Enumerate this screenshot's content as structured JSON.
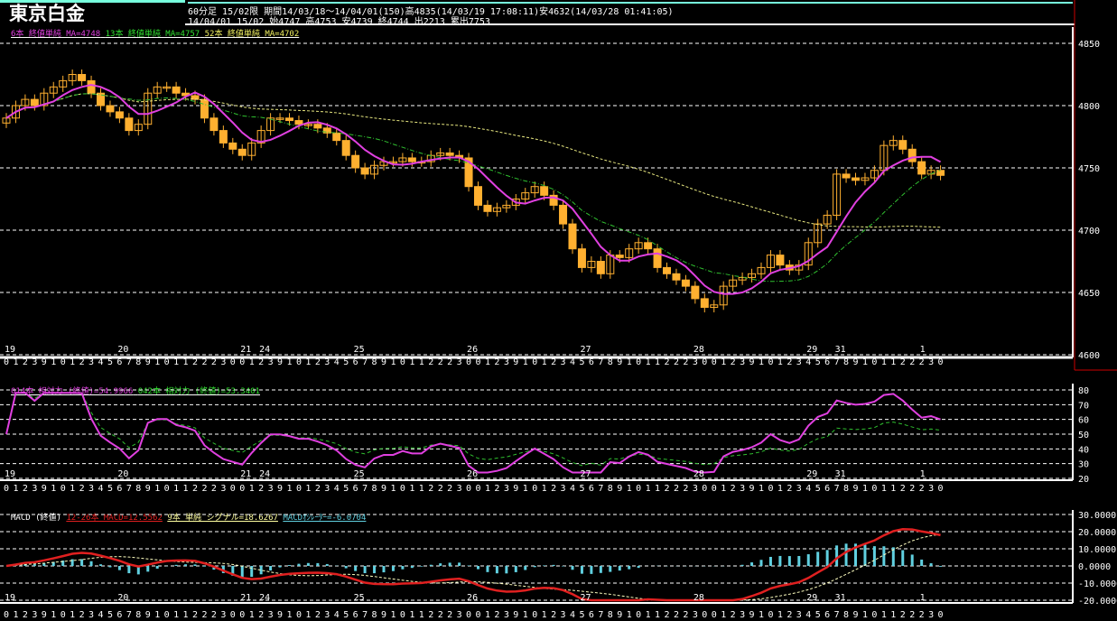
{
  "header": {
    "title": "東京白金",
    "line1": "60分足 15/02限  期間14/03/18～14/04/01(150)高4835(14/03/19 17:08:11)安4632(14/03/28 01:41:05)",
    "line2": "14/04/01 15/02 始4747 高4753 安4739 終4744 出2213 累出7753"
  },
  "legend_main": {
    "ma6": "6本 終値単純 MA=4748",
    "ma13": "13本 終値単純 MA=4757",
    "ma52": "52本 終値単純 MA=4702"
  },
  "legend_rsi": {
    "rsi14": "014本 相対力 (終値)=54.9966",
    "rsi42": "042本 相対力 (終値)=53.3401"
  },
  "legend_macd": {
    "title": "MACD (終値)",
    "macd": "12-26本 MACD=12.5562",
    "signal": "9本 単純 シグナル=18.6267",
    "osc": "MACDｵｼﾚｰﾀｰ=-6.0704"
  },
  "colors": {
    "candle": "#ffb030",
    "ma6": "#e040e0",
    "ma13": "#30c030",
    "ma52": "#e8e880",
    "macd": "#e02020",
    "signal": "#ffffc0",
    "osc": "#60d0e0",
    "grid": "#ffffff"
  },
  "hour_ticks": "0123910123456789101122230",
  "chart_data": [
    {
      "type": "candlestick",
      "ylim": [
        4600,
        4850
      ],
      "yticks": [
        "4850",
        "4800",
        "4750",
        "4700",
        "4650",
        "4600"
      ],
      "close": [
        4790,
        4800,
        4805,
        4800,
        4810,
        4815,
        4820,
        4825,
        4820,
        4810,
        4800,
        4795,
        4790,
        4780,
        4785,
        4810,
        4815,
        4815,
        4810,
        4808,
        4805,
        4790,
        4780,
        4770,
        4765,
        4760,
        4770,
        4780,
        4790,
        4790,
        4788,
        4785,
        4785,
        4782,
        4778,
        4772,
        4760,
        4750,
        4745,
        4752,
        4755,
        4755,
        4758,
        4755,
        4755,
        4760,
        4762,
        4760,
        4758,
        4735,
        4720,
        4715,
        4718,
        4720,
        4725,
        4730,
        4735,
        4728,
        4720,
        4705,
        4685,
        4670,
        4675,
        4665,
        4680,
        4678,
        4685,
        4690,
        4685,
        4670,
        4665,
        4660,
        4655,
        4645,
        4638,
        4640,
        4655,
        4660,
        4662,
        4665,
        4670,
        4680,
        4672,
        4668,
        4672,
        4690,
        4705,
        4712,
        4745,
        4742,
        4740,
        4742,
        4748,
        4768,
        4772,
        4765,
        4755,
        4745,
        4748,
        4744
      ],
      "date_labels": [
        {
          "label": "19",
          "bar": 0
        },
        {
          "label": "20",
          "bar": 12
        },
        {
          "label": "21",
          "bar": 25
        },
        {
          "label": "24",
          "bar": 27
        },
        {
          "label": "25",
          "bar": 37
        },
        {
          "label": "26",
          "bar": 49
        },
        {
          "label": "27",
          "bar": 61
        },
        {
          "label": "28",
          "bar": 73
        },
        {
          "label": "29",
          "bar": 85
        },
        {
          "label": "31",
          "bar": 88
        },
        {
          "label": "1",
          "bar": 97
        }
      ]
    },
    {
      "type": "line",
      "name": "RSI",
      "ylim": [
        20,
        80
      ],
      "yticks": [
        "80",
        "70",
        "60",
        "50",
        "40",
        "30",
        "20"
      ]
    },
    {
      "type": "line",
      "name": "MACD",
      "ylim": [
        -20,
        30
      ],
      "yticks": [
        "30.0000",
        "20.0000",
        "10.0000",
        "0.0000",
        "-10.0000",
        "-20.0000"
      ]
    }
  ]
}
